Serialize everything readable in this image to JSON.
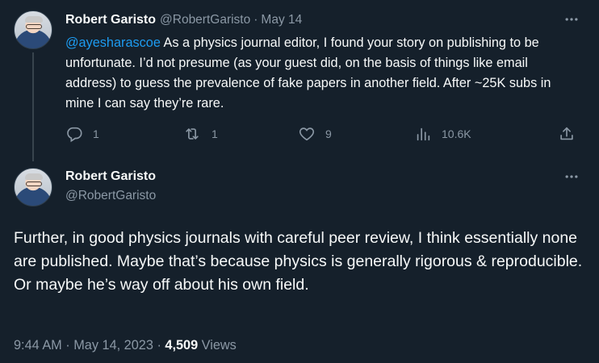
{
  "parent_tweet": {
    "author_name": "Robert Garisto",
    "author_handle": "@RobertGaristo",
    "separator": "·",
    "date": "May 14",
    "mention": "@ayesharascoe",
    "text": " As a physics journal editor, I found your story on publishing to be unfortunate. I’d not presume (as your guest did, on the basis of things like email address) to guess the prevalence of fake papers in another field. After ~25K subs in mine I can say they’re rare.",
    "actions": {
      "replies": "1",
      "retweets": "1",
      "likes": "9",
      "views": "10.6K"
    },
    "icons": {
      "more": "more-icon",
      "reply": "reply-icon",
      "retweet": "retweet-icon",
      "like": "heart-icon",
      "views": "analytics-icon",
      "share": "share-icon"
    }
  },
  "focal_tweet": {
    "author_name": "Robert Garisto",
    "author_handle": "@RobertGaristo",
    "text": "Further, in good physics journals with careful peer review, I think essentially none are published. Maybe that’s because physics is generally rigorous & reproducible. Or maybe he’s way off about his own field.",
    "time": "9:44 AM",
    "separator": "·",
    "date": "May 14, 2023",
    "views_count": "4,509",
    "views_label": "Views"
  },
  "colors": {
    "background": "#15202b",
    "text": "#f7f9f9",
    "secondary": "#8b98a5",
    "accent": "#1d9bf0",
    "thread_line": "#38444d"
  }
}
